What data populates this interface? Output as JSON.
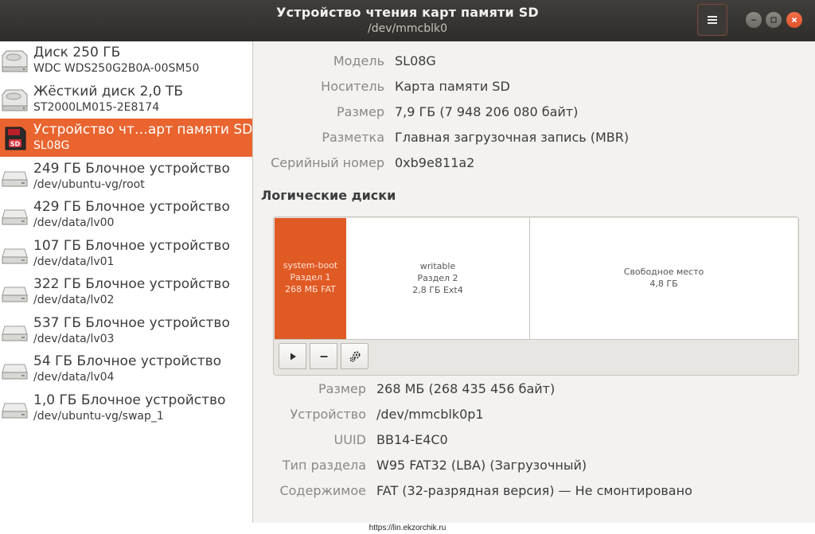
{
  "window": {
    "title": "Устройство чтения карт памяти SD",
    "subtitle": "/dev/mmcblk0"
  },
  "titlebar_icons": {
    "menu": "hamburger-menu-icon",
    "minimize": "minimize-icon",
    "maximize": "maximize-icon",
    "close": "close-icon"
  },
  "devices": [
    {
      "name": "Диск 250 ГБ",
      "sub": "WDC WDS250G2B0A-00SM50",
      "icon": "disk-icon"
    },
    {
      "name": "Жёсткий диск 2,0 ТБ",
      "sub": "ST2000LM015-2E8174",
      "icon": "disk-icon"
    },
    {
      "name": "Устройство чт…арт памяти SD",
      "sub": "SL08G",
      "icon": "sd-card-icon",
      "selected": true
    },
    {
      "name": "249 ГБ Блочное устройство",
      "sub": "/dev/ubuntu-vg/root",
      "icon": "block-device-icon"
    },
    {
      "name": "429 ГБ Блочное устройство",
      "sub": "/dev/data/lv00",
      "icon": "block-device-icon"
    },
    {
      "name": "107 ГБ Блочное устройство",
      "sub": "/dev/data/lv01",
      "icon": "block-device-icon"
    },
    {
      "name": "322 ГБ Блочное устройство",
      "sub": "/dev/data/lv02",
      "icon": "block-device-icon"
    },
    {
      "name": "537 ГБ Блочное устройство",
      "sub": "/dev/data/lv03",
      "icon": "block-device-icon"
    },
    {
      "name": "54 ГБ Блочное устройство",
      "sub": "/dev/data/lv04",
      "icon": "block-device-icon"
    },
    {
      "name": "1,0 ГБ Блочное устройство",
      "sub": "/dev/ubuntu-vg/swap_1",
      "icon": "block-device-icon"
    }
  ],
  "drive_props": [
    {
      "label": "Модель",
      "value": "SL08G"
    },
    {
      "label": "Носитель",
      "value": "Карта памяти SD"
    },
    {
      "label": "Размер",
      "value": "7,9 ГБ (7 948 206 080 байт)"
    },
    {
      "label": "Разметка",
      "value": "Главная загрузочная запись (MBR)"
    },
    {
      "label": "Серийный номер",
      "value": "0xb9e811a2"
    }
  ],
  "volumes_title": "Логические диски",
  "partitions": [
    {
      "name": "system-boot",
      "part": "Раздел 1",
      "size": "268 МБ FAT"
    },
    {
      "name": "writable",
      "part": "Раздел 2",
      "size": "2,8 ГБ Ext4"
    },
    {
      "name": "Свободное место",
      "size": "4,8 ГБ"
    }
  ],
  "toolbar_icons": {
    "mount": "play-icon",
    "remove": "minus-icon",
    "settings": "gears-icon"
  },
  "volume_props": [
    {
      "label": "Размер",
      "value": "268 МБ (268 435 456 байт)"
    },
    {
      "label": "Устройство",
      "value": "/dev/mmcblk0p1"
    },
    {
      "label": "UUID",
      "value": "BB14-E4C0"
    },
    {
      "label": "Тип раздела",
      "value": "W95 FAT32 (LBA) (Загрузочный)"
    },
    {
      "label": "Содержимое",
      "value": "FAT (32-разрядная версия) — Не смонтировано"
    }
  ],
  "footer": {
    "url": "https://lin.ekzorchik.ru"
  },
  "colors": {
    "accent": "#e9642f",
    "titlebar": "#36352f"
  }
}
